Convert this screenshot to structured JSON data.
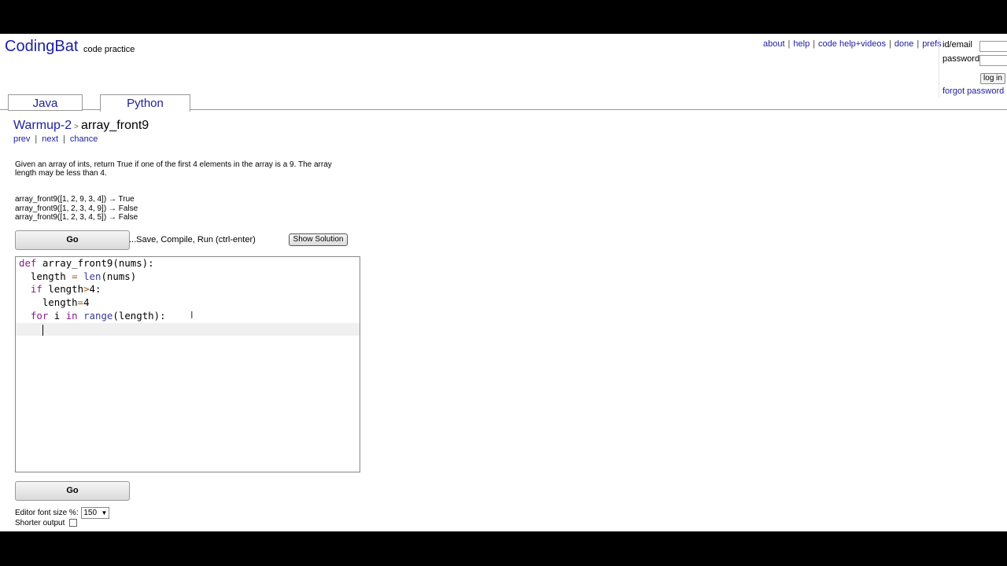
{
  "header": {
    "logo": "CodingBat",
    "logo_sub": "code practice",
    "nav": [
      "about",
      "help",
      "code help+videos",
      "done",
      "prefs"
    ]
  },
  "login": {
    "id_label": "id/email",
    "password_label": "password",
    "login_button": "log in",
    "forgot": "forgot password |"
  },
  "tabs": [
    {
      "label": "Java"
    },
    {
      "label": "Python"
    }
  ],
  "breadcrumb": {
    "category": "Warmup-2",
    "arrow": ">",
    "problem": "array_front9"
  },
  "problem_nav": {
    "prev": "prev",
    "next": "next",
    "chance": "chance"
  },
  "description": "Given an array of ints, return True if one of the first 4 elements in the array is a 9. The array length may be less than 4.",
  "examples": [
    "array_front9([1, 2, 9, 3, 4]) → True",
    "array_front9([1, 2, 3, 4, 9]) → False",
    "array_front9([1, 2, 3, 4, 5]) → False"
  ],
  "controls": {
    "go_label": "Go",
    "save_text": "...Save, Compile, Run (ctrl-enter)",
    "show_solution": "Show Solution"
  },
  "editor": {
    "lines": [
      "def array_front9(nums):",
      "  length = len(nums)",
      "  if length>4:",
      "    length=4",
      "  for i in range(length):",
      "    "
    ]
  },
  "options": {
    "font_size_label": "Editor font size %:",
    "font_size_value": "150",
    "shorter_output_label": "Shorter output"
  }
}
